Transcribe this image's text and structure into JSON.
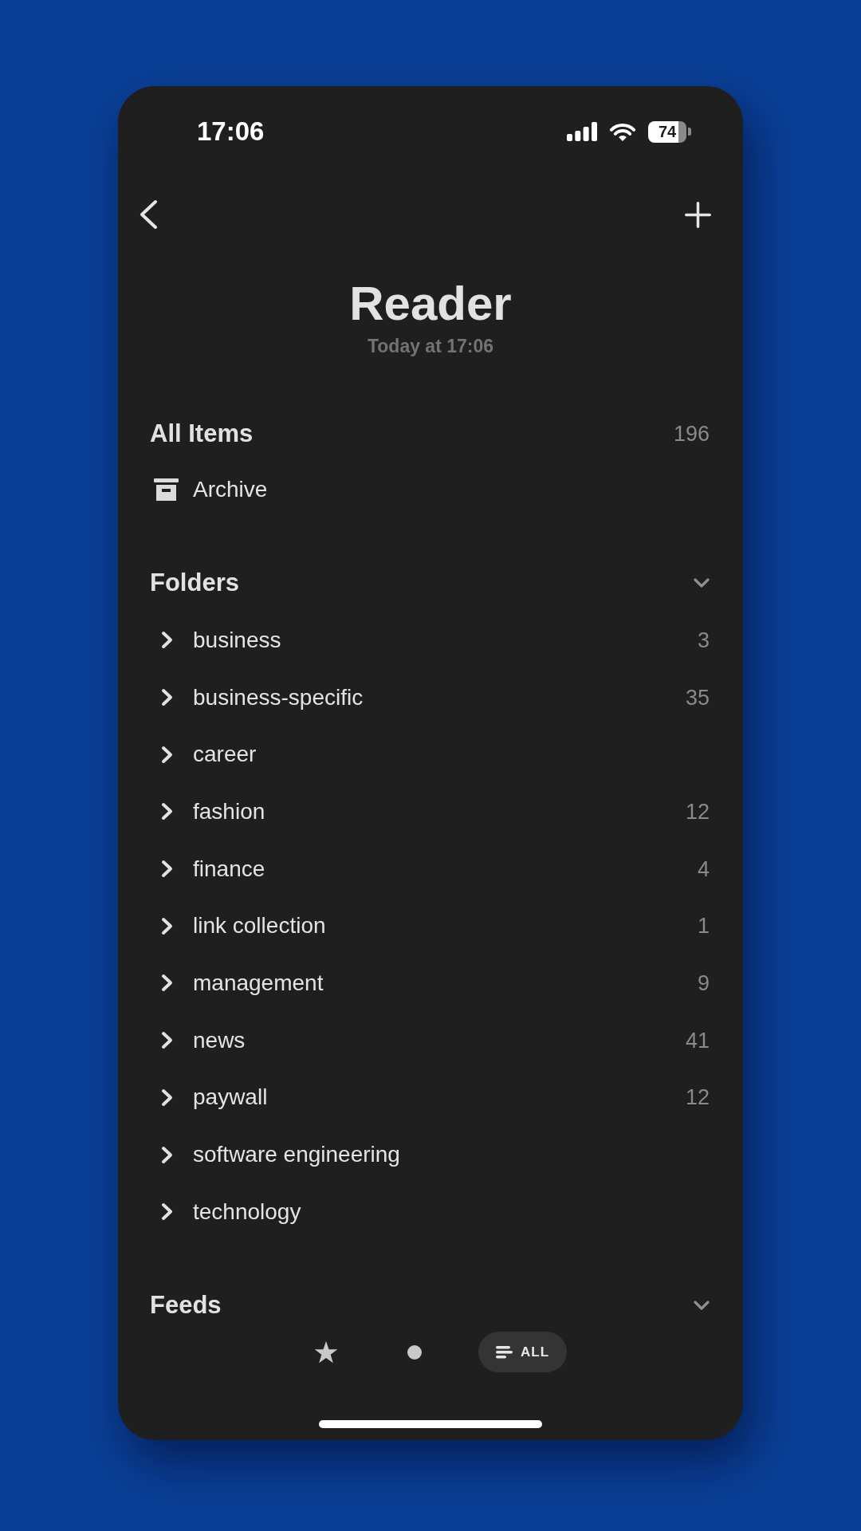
{
  "status_bar": {
    "time": "17:06",
    "battery": "74"
  },
  "header": {
    "title": "Reader",
    "subtitle": "Today at 17:06"
  },
  "all_items": {
    "label": "All Items",
    "count": "196"
  },
  "archive": {
    "label": "Archive"
  },
  "sections": [
    {
      "title": "Folders",
      "expanded": true,
      "items": [
        {
          "label": "business",
          "count": "3",
          "expanded": false
        },
        {
          "label": "business-specific",
          "count": "35",
          "expanded": false
        },
        {
          "label": "career",
          "expanded": false
        },
        {
          "label": "fashion",
          "count": "12",
          "expanded": false
        },
        {
          "label": "finance",
          "count": "4",
          "expanded": false
        },
        {
          "label": "link collection",
          "count": "1",
          "expanded": false
        },
        {
          "label": "management",
          "count": "9",
          "expanded": false
        },
        {
          "label": "news",
          "count": "41",
          "expanded": false
        },
        {
          "label": "paywall",
          "count": "12",
          "expanded": false
        },
        {
          "label": "software engineering",
          "expanded": false
        },
        {
          "label": "technology",
          "expanded": false
        }
      ]
    },
    {
      "title": "Feeds",
      "expanded": true
    }
  ],
  "filters": [
    {
      "kind": "star",
      "selected": false
    },
    {
      "kind": "dot",
      "selected": false
    },
    {
      "kind": "list",
      "label": "ALL",
      "selected": true
    }
  ]
}
